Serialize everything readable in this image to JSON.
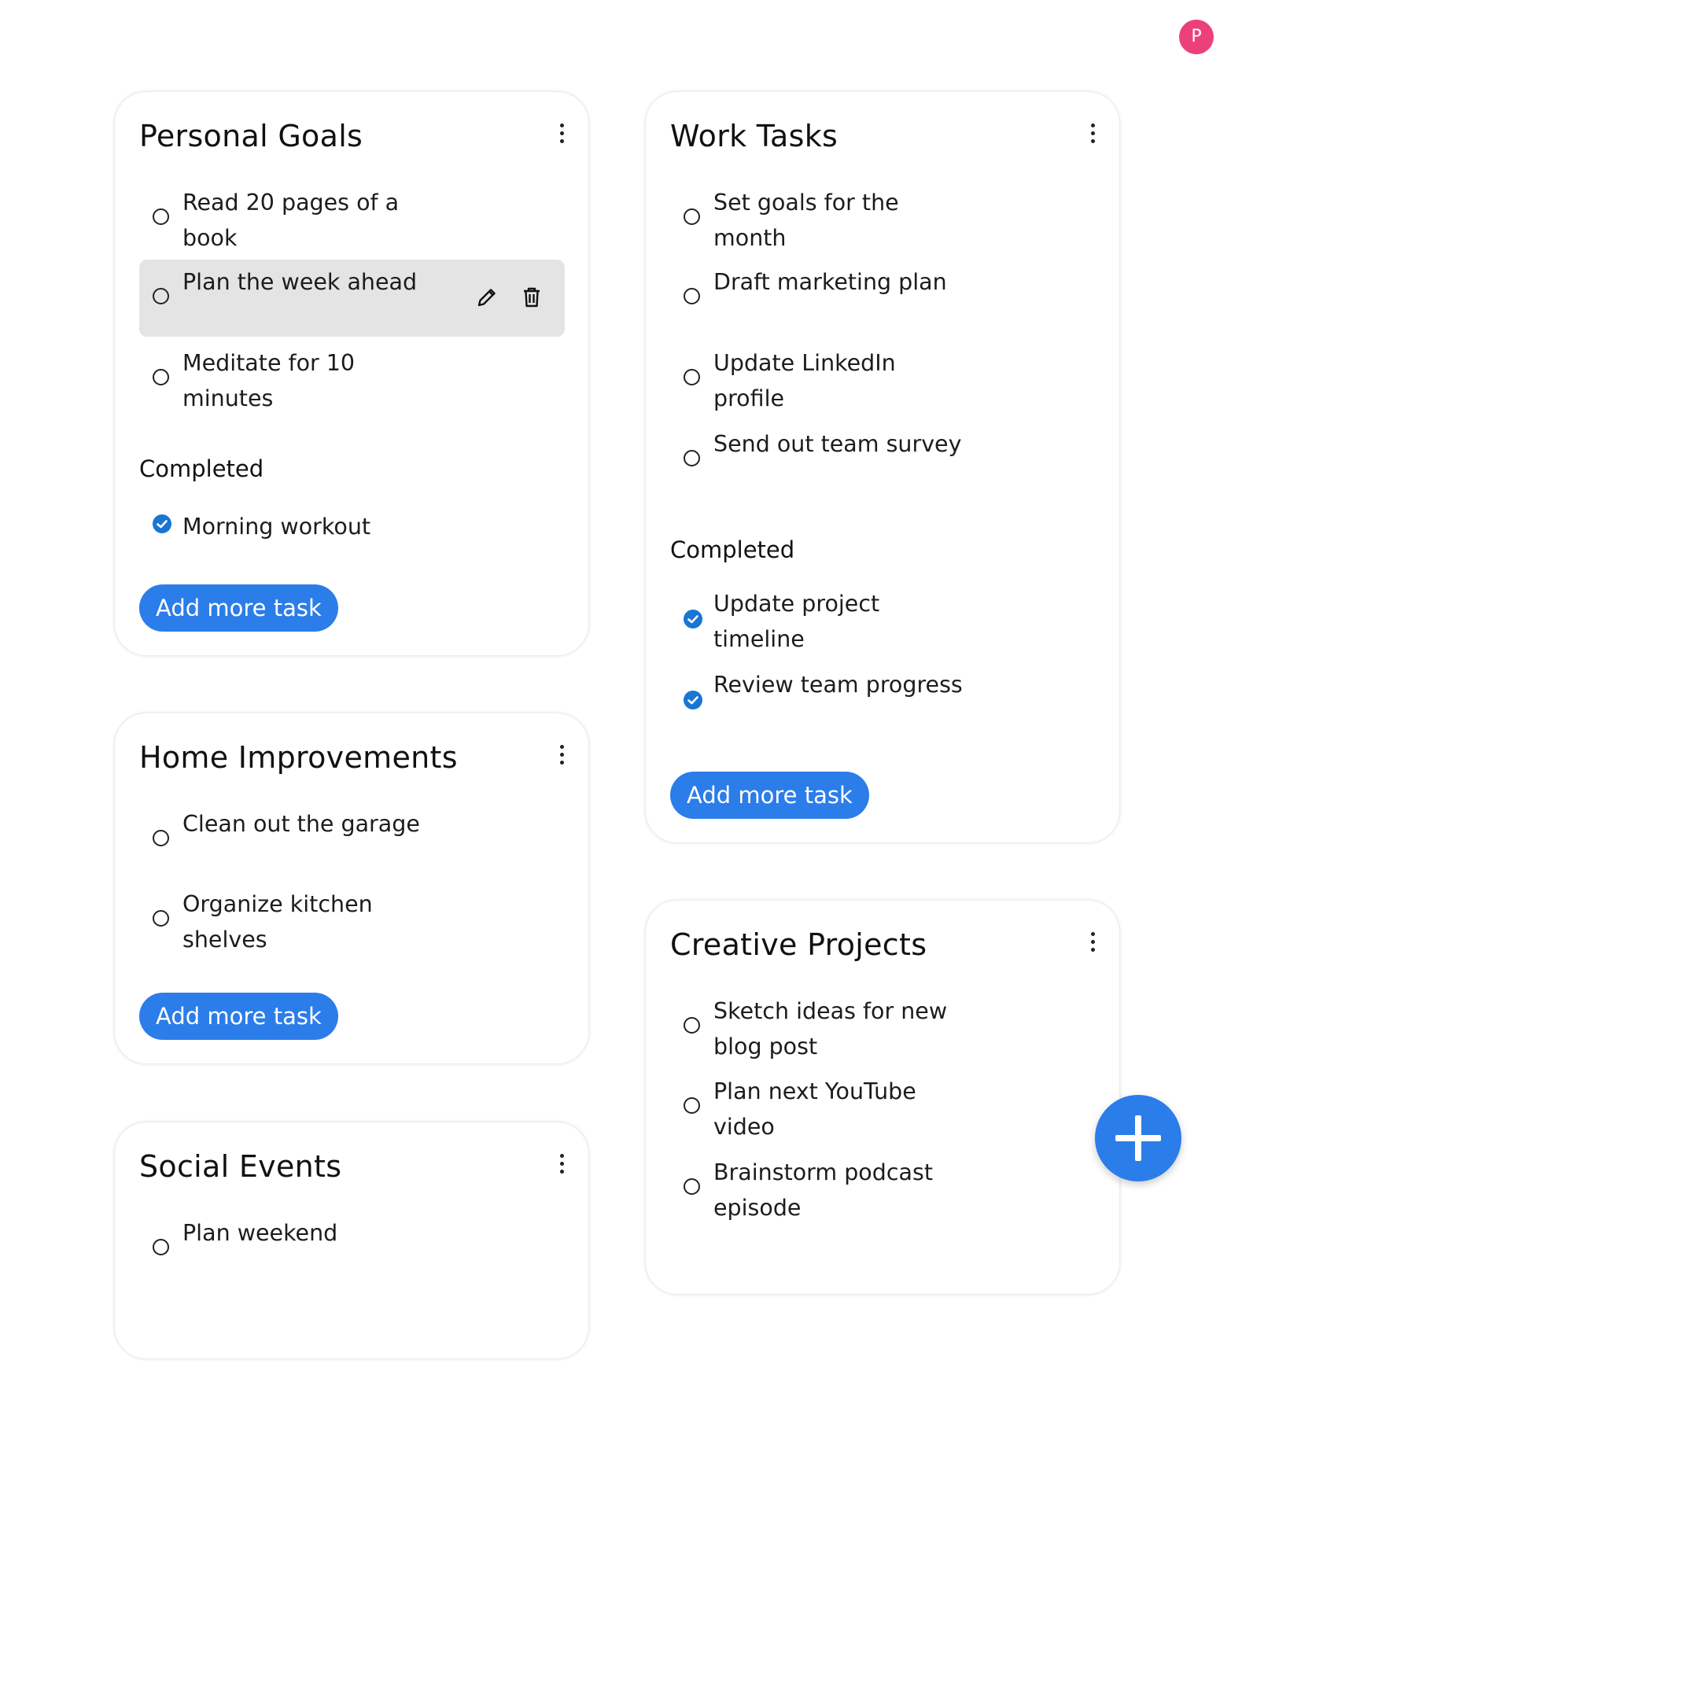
{
  "user": {
    "avatar_initial": "P"
  },
  "colors": {
    "accent": "#2b7de9",
    "check": "#1976d2",
    "avatar": "#ec407a",
    "hover_row": "#e4e4e4"
  },
  "cards": [
    {
      "title": "Personal Goals",
      "tasks": [
        "Read 20 pages of a book",
        "Plan the week ahead",
        "Meditate for 10 minutes"
      ],
      "completed_label": "Completed",
      "completed": [
        "Morning workout"
      ],
      "add_label": "Add more task"
    },
    {
      "title": "Work Tasks",
      "tasks": [
        "Set goals for the month",
        "Draft marketing plan",
        "Update LinkedIn profile",
        "Send out team survey"
      ],
      "completed_label": "Completed",
      "completed": [
        "Update project timeline",
        "Review team progress"
      ],
      "add_label": "Add more task"
    },
    {
      "title": "Home Improvements",
      "tasks": [
        "Clean out the garage",
        "Organize kitchen shelves"
      ],
      "add_label": "Add more task"
    },
    {
      "title": "Creative Projects",
      "tasks": [
        "Sketch ideas for new blog post",
        "Plan next YouTube video",
        "Brainstorm podcast episode"
      ]
    },
    {
      "title": "Social Events",
      "tasks": [
        "Plan weekend"
      ]
    }
  ],
  "icons": {
    "edit": "pencil-icon",
    "delete": "trash-icon",
    "menu": "kebab-menu-icon",
    "fab": "plus-icon"
  }
}
